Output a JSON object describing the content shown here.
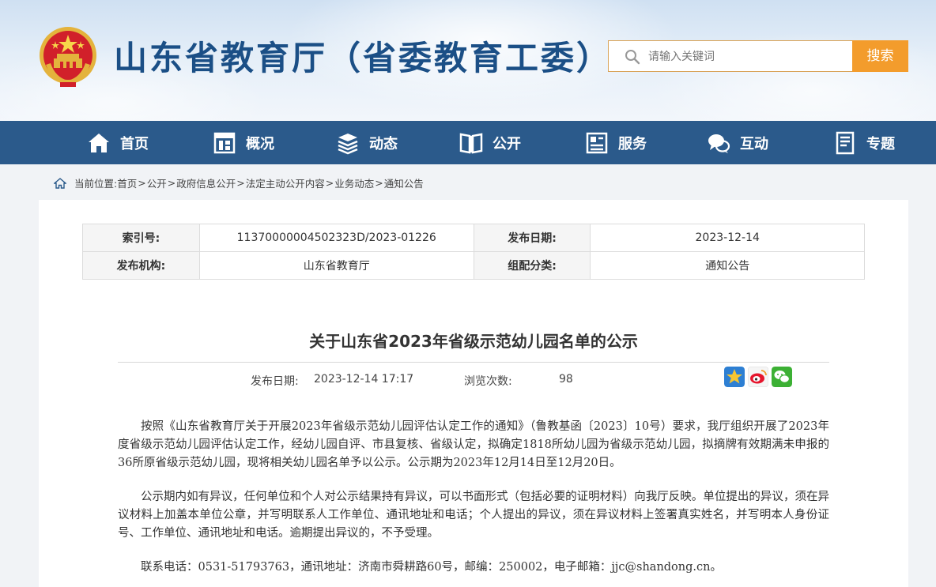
{
  "header": {
    "site_title": "山东省教育厅（省委教育工委）",
    "search_placeholder": "请输入关键词",
    "search_button": "搜索"
  },
  "nav": {
    "items": [
      {
        "label": "首页",
        "icon": "home-icon"
      },
      {
        "label": "概况",
        "icon": "building-icon"
      },
      {
        "label": "动态",
        "icon": "news-stack-icon"
      },
      {
        "label": "公开",
        "icon": "open-book-icon"
      },
      {
        "label": "服务",
        "icon": "service-icon"
      },
      {
        "label": "互动",
        "icon": "chat-icon"
      },
      {
        "label": "专题",
        "icon": "document-icon"
      }
    ]
  },
  "breadcrumb": {
    "prefix": "当前位置:",
    "items": [
      "首页",
      "公开",
      "政府信息公开",
      "法定主动公开内容",
      "业务动态",
      "通知公告"
    ],
    "separator": ">"
  },
  "meta": {
    "index_label": "索引号:",
    "index_value": "11370000004502323D/2023-01226",
    "date_label": "发布日期:",
    "date_value": "2023-12-14",
    "org_label": "发布机构:",
    "org_value": "山东省教育厅",
    "category_label": "组配分类:",
    "category_value": "通知公告"
  },
  "article": {
    "title": "关于山东省2023年省级示范幼儿园名单的公示",
    "publish_label": "发布日期:",
    "publish_value": "2023-12-14 17:17",
    "views_label": "浏览次数:",
    "views_value": "98",
    "paragraphs": [
      "按照《山东省教育厅关于开展2023年省级示范幼儿园评估认定工作的通知》（鲁教基函〔2023〕10号）要求，我厅组织开展了2023年度省级示范幼儿园评估认定工作，经幼儿园自评、市县复核、省级认定，拟确定1818所幼儿园为省级示范幼儿园，拟摘牌有效期满未申报的36所原省级示范幼儿园，现将相关幼儿园名单予以公示。公示期为2023年12月14日至12月20日。",
      "公示期内如有异议，任何单位和个人对公示结果持有异议，可以书面形式（包括必要的证明材料）向我厅反映。单位提出的异议，须在异议材料上加盖本单位公章，并写明联系人工作单位、通讯地址和电话；个人提出的异议，须在异议材料上签署真实姓名，并写明本人身份证号、工作单位、通讯地址和电话。逾期提出异议的，不予受理。",
      "联系电话：0531-51793763，通讯地址：济南市舜耕路60号，邮编：250002，电子邮箱：jjc@shandong.cn。"
    ]
  },
  "colors": {
    "nav_bg": "#2b5a8b",
    "title_blue": "#1b4f86",
    "search_orange": "#f39c2c"
  }
}
